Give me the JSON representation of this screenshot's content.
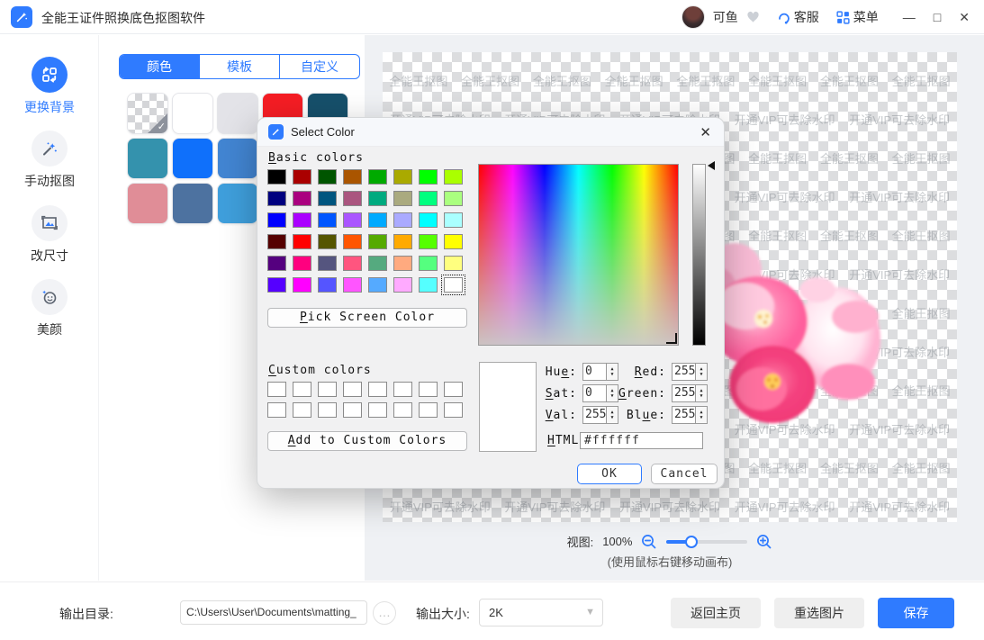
{
  "app": {
    "title": "全能王证件照换底色抠图软件",
    "username": "可鱼",
    "service_label": "客服",
    "menu_label": "菜单",
    "window": {
      "minimize": "—",
      "maximize": "□",
      "close": "✕"
    },
    "accent_color": "#2f7bff"
  },
  "sidebar": {
    "items": [
      {
        "label": "更换背景",
        "icon": "swap-background-icon",
        "active": true
      },
      {
        "label": "手动抠图",
        "icon": "magic-wand-icon",
        "active": false
      },
      {
        "label": "改尺寸",
        "icon": "resize-image-icon",
        "active": false
      },
      {
        "label": "美颜",
        "icon": "beauty-face-icon",
        "active": false
      }
    ]
  },
  "panel": {
    "tabs": [
      {
        "label": "颜色",
        "active": true
      },
      {
        "label": "模板",
        "active": false
      },
      {
        "label": "自定义",
        "active": false
      }
    ],
    "swatch_rows": [
      [
        {
          "type": "transparent",
          "selected": true
        },
        {
          "color": "#ffffff"
        },
        {
          "color": "#e3e3e8"
        },
        {
          "color": "#f51d24"
        },
        {
          "color": "#16506b"
        }
      ],
      [
        {
          "color": "#3492ad"
        },
        {
          "color": "#0f70fb"
        },
        {
          "color": "#4285d2"
        }
      ],
      [
        {
          "color": "#e08d97"
        },
        {
          "color": "#4d72a0"
        },
        {
          "color": "#3f9fdc"
        }
      ]
    ]
  },
  "dialog": {
    "title": "Select Color",
    "labels": {
      "basic": {
        "pre": "",
        "mn": "B",
        "post": "asic colors"
      },
      "pick": {
        "pre": "",
        "mn": "P",
        "post": "ick Screen Color"
      },
      "custom": {
        "pre": "",
        "mn": "C",
        "post": "ustom colors"
      },
      "add": {
        "pre": "",
        "mn": "A",
        "post": "dd to Custom Colors"
      },
      "hue": {
        "pre": "Hu",
        "mn": "e",
        "post": ":"
      },
      "sat": {
        "pre": "",
        "mn": "S",
        "post": "at:"
      },
      "val": {
        "pre": "",
        "mn": "V",
        "post": "al:"
      },
      "red": {
        "pre": "",
        "mn": "R",
        "post": "ed:"
      },
      "green": {
        "pre": "",
        "mn": "G",
        "post": "reen:"
      },
      "blue": {
        "pre": "Bl",
        "mn": "u",
        "post": "e:"
      },
      "html": {
        "pre": "",
        "mn": "H",
        "post": "TML:"
      }
    },
    "values": {
      "hue": "0",
      "sat": "0",
      "val": "255",
      "red": "255",
      "green": "255",
      "blue": "255",
      "html": "#ffffff"
    },
    "buttons": {
      "ok": "OK",
      "cancel": "Cancel"
    },
    "basic_colors": [
      "#000000",
      "#aa0000",
      "#005500",
      "#aa5500",
      "#00aa00",
      "#aaaa00",
      "#00ff00",
      "#aaff00",
      "#00007f",
      "#aa007f",
      "#00557f",
      "#aa557f",
      "#00aa7f",
      "#aaaa7f",
      "#00ff7f",
      "#aaff7f",
      "#0000ff",
      "#aa00ff",
      "#0055ff",
      "#aa55ff",
      "#00aaff",
      "#aaaaff",
      "#00ffff",
      "#aaffff",
      "#550000",
      "#ff0000",
      "#555500",
      "#ff5500",
      "#55aa00",
      "#ffaa00",
      "#55ff00",
      "#ffff00",
      "#55007f",
      "#ff007f",
      "#55557f",
      "#ff557f",
      "#55aa7f",
      "#ffaa7f",
      "#55ff7f",
      "#ffff7f",
      "#5500ff",
      "#ff00ff",
      "#5555ff",
      "#ff55ff",
      "#55aaff",
      "#ffaaff",
      "#55ffff",
      "#ffffff"
    ],
    "basic_selected_index": 47,
    "custom_colors": [
      "#ffffff",
      "#ffffff",
      "#ffffff",
      "#ffffff",
      "#ffffff",
      "#ffffff",
      "#ffffff",
      "#ffffff",
      "#ffffff",
      "#ffffff",
      "#ffffff",
      "#ffffff",
      "#ffffff",
      "#ffffff",
      "#ffffff",
      "#ffffff"
    ],
    "current_color": "#ffffff"
  },
  "canvas": {
    "watermark_brand": "全能王抠图",
    "watermark_vip": "开通VIP可去除水印",
    "image_alt": "pink-flower-cutout"
  },
  "viewbar": {
    "view_label": "视图:",
    "zoom_value": "100%",
    "hint": "(使用鼠标右键移动画布)"
  },
  "footer": {
    "output_dir_label": "输出目录:",
    "output_dir_value": "C:\\Users\\User\\Documents\\matting_",
    "ellipsis": "…",
    "output_size_label": "输出大小:",
    "output_size_value": "2K",
    "home_button": "返回主页",
    "reselect_button": "重选图片",
    "save_button": "保存"
  }
}
